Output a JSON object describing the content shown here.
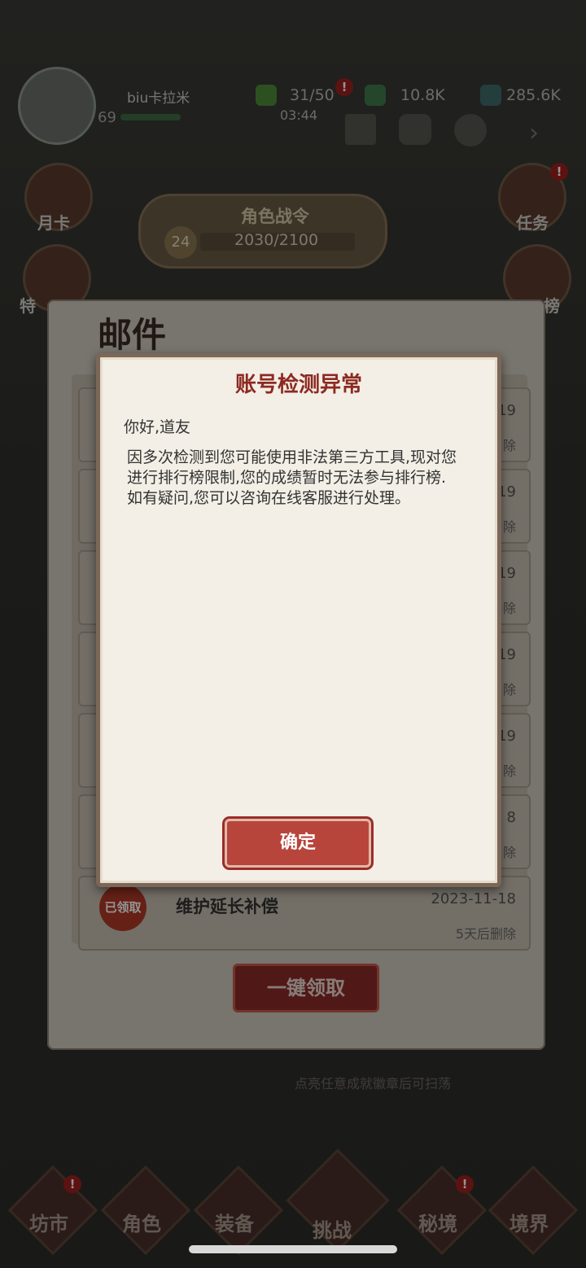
{
  "player": {
    "name": "biu卡拉米",
    "level": "69"
  },
  "resources": [
    {
      "name": "stamina",
      "value": "31/50",
      "timer": "03:44"
    },
    {
      "name": "jade",
      "value": "10.8K"
    },
    {
      "name": "spirit-stone",
      "value": "285.6K"
    }
  ],
  "side_left": [
    "月卡",
    "特"
  ],
  "side_right": [
    "任务",
    "榜"
  ],
  "battle_pass": {
    "title": "角色战令",
    "level": "24",
    "progress": "2030/2100"
  },
  "mail": {
    "title": "邮件",
    "rows": [
      {
        "date": "-19",
        "expire": "除"
      },
      {
        "date": "-19",
        "expire": "除"
      },
      {
        "date": "-19",
        "expire": "除"
      },
      {
        "date": "-19",
        "expire": "除"
      },
      {
        "date": "19",
        "expire": "除"
      },
      {
        "date": "8",
        "expire": "除"
      },
      {
        "subject": "维护延长补偿",
        "date": "2023-11-18",
        "expire": "5天后删除",
        "stamp": "已领取"
      }
    ],
    "claim_all": "一键领取",
    "hint": "点亮任意成就徽章后可扫荡"
  },
  "bottom_nav": [
    "坊市",
    "角色",
    "装备",
    "挑战",
    "秘境",
    "境界"
  ],
  "dialog": {
    "title": "账号检测异常",
    "greeting": "你好,道友",
    "body": "因多次检测到您可能使用非法第三方工具,现对您进行排行榜限制,您的成绩暂时无法参与排行榜.如有疑问,您可以咨询在线客服进行处理。",
    "confirm": "确定"
  }
}
